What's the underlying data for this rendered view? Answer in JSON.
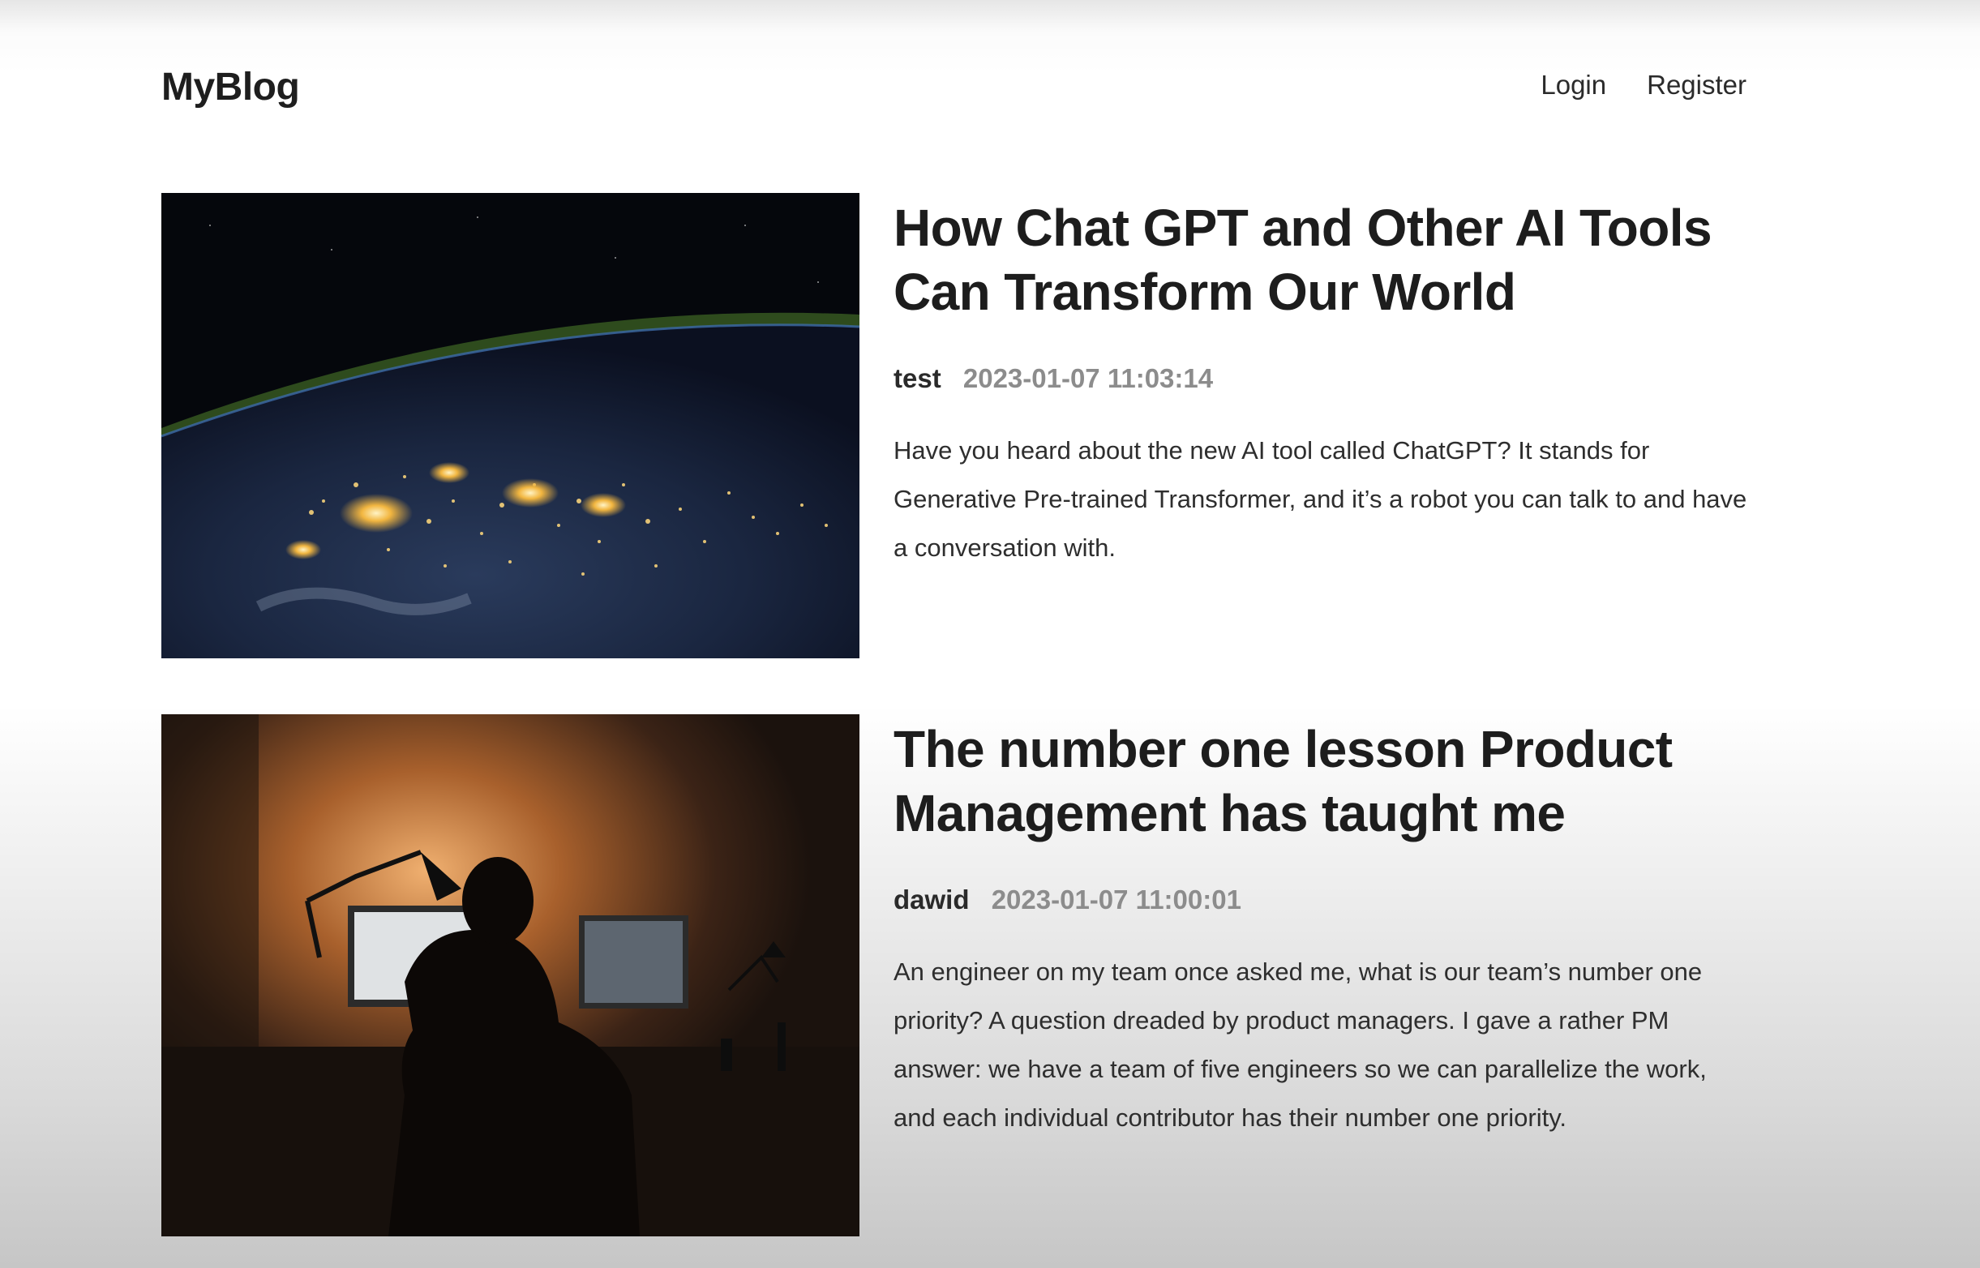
{
  "header": {
    "logo": "MyBlog",
    "nav": {
      "login": "Login",
      "register": "Register"
    }
  },
  "posts": [
    {
      "title": "How Chat GPT and Other AI Tools Can Transform Our World",
      "author": "test",
      "date": "2023-01-07 11:03:14",
      "excerpt": "Have you heard about the new AI tool called ChatGPT? It stands for Generative Pre-trained Transformer, and it’s a robot you can talk to and have a conversation with.",
      "image": "earth-at-night-image"
    },
    {
      "title": "The number one lesson Product Management has taught me",
      "author": "dawid",
      "date": "2023-01-07 11:00:01",
      "excerpt": "An engineer on my team once asked me, what is our team’s number one priority? A question dreaded by product managers. I gave a rather PM answer: we have a team of five engineers so we can parallelize the work, and each individual contributor has their number one priority.",
      "image": "person-at-desk-image"
    }
  ]
}
